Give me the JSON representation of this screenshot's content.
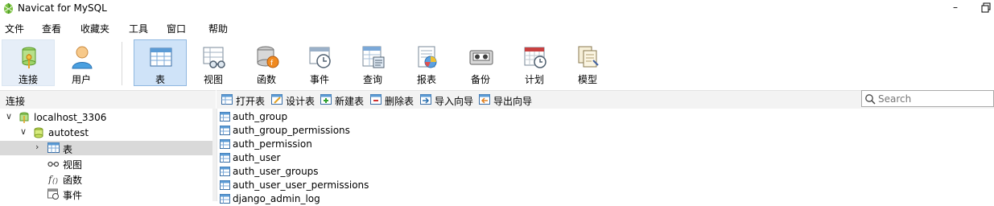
{
  "window": {
    "title": "Navicat for MySQL",
    "minimize": "–"
  },
  "menu": [
    "文件",
    "查看",
    "收藏夹",
    "工具",
    "窗口",
    "帮助"
  ],
  "toolbar": {
    "buttons": [
      {
        "label": "连接",
        "icon": "connection-icon"
      },
      {
        "label": "用户",
        "icon": "user-icon"
      },
      {
        "label": "表",
        "icon": "table-icon",
        "active": true
      },
      {
        "label": "视图",
        "icon": "view-icon"
      },
      {
        "label": "函数",
        "icon": "function-icon"
      },
      {
        "label": "事件",
        "icon": "event-icon"
      },
      {
        "label": "查询",
        "icon": "query-icon"
      },
      {
        "label": "报表",
        "icon": "report-icon"
      },
      {
        "label": "备份",
        "icon": "backup-icon"
      },
      {
        "label": "计划",
        "icon": "schedule-icon"
      },
      {
        "label": "模型",
        "icon": "model-icon"
      }
    ]
  },
  "left_panel": {
    "header": "连接"
  },
  "object_toolbar": {
    "buttons": [
      "打开表",
      "设计表",
      "新建表",
      "删除表",
      "导入向导",
      "导出向导"
    ]
  },
  "search": {
    "placeholder": "Search"
  },
  "tree": [
    {
      "label": "localhost_3306",
      "arrow": "∨"
    },
    {
      "label": "autotest",
      "arrow": "∨"
    },
    {
      "label": "表",
      "arrow": "›",
      "selected": true
    },
    {
      "label": "视图"
    },
    {
      "label": "函数"
    },
    {
      "label": "事件"
    }
  ],
  "tables": [
    "auth_group",
    "auth_group_permissions",
    "auth_permission",
    "auth_user",
    "auth_user_groups",
    "auth_user_user_permissions",
    "django_admin_log"
  ],
  "colors": {
    "active_tab_bg": "#cfe3f8",
    "selected_row": "#d9d9d9",
    "panel_header": "#f3f3f3"
  }
}
